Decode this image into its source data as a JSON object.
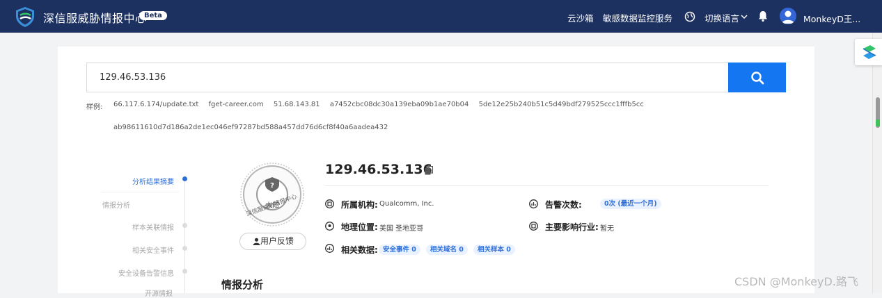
{
  "header": {
    "brand": "深信服威胁情报中心",
    "badge": "Beta",
    "nav": [
      "云沙箱",
      "敏感数据监控服务"
    ],
    "language": "切换语言",
    "user": "MonkeyD王...",
    "bg_color": "#1c3160"
  },
  "search": {
    "value": "129.46.53.136",
    "examples_label": "样例:",
    "examples": [
      "66.117.6.174/update.txt",
      "fget-career.com",
      "51.68.143.81",
      "a7452cbc08dc30a139eba09b1ae70b04",
      "5de12e25b240b51c5d49bdf279525ccc1fffb5cc"
    ],
    "examples_line2": "ab98611610d7d186a2de1ec046ef97287bd588a457dd76d6cf8f40a6aadea432",
    "button_color": "#1476f0"
  },
  "anchor_nav": {
    "items": [
      "分析结果摘要",
      "情报分析",
      "样本关联情报",
      "相关安全事件",
      "安全设备告警信息",
      "开源情报"
    ],
    "active_color": "#2f6fd8"
  },
  "result": {
    "seal_status": "未知",
    "seal_text": "深信服威胁情报中心",
    "feedback": "用户反馈",
    "ip": "129.46.53.136",
    "org_label": "所属机构:",
    "org_value": "Qualcomm, Inc.",
    "geo_label": "地理位置:",
    "geo_value": "美国 圣地亚哥",
    "related_label": "相关数据:",
    "related": [
      "安全事件  0",
      "相关域名  0",
      "相关样本  0"
    ],
    "alerts_label": "告警次数:",
    "alerts_value": "0次 (最近一个月)",
    "industry_label": "主要影响行业:",
    "industry_value": "暂无"
  },
  "section_title": "情报分析",
  "watermark": "CSDN @MonkeyD.路飞"
}
